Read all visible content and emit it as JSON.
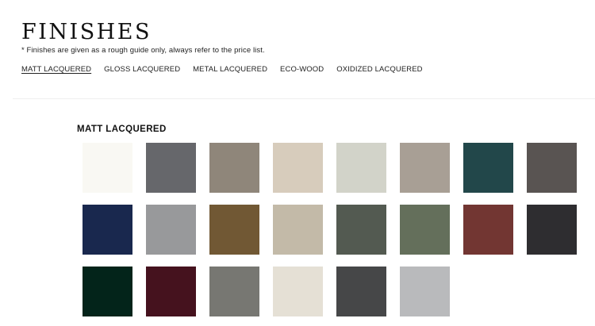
{
  "header": {
    "title": "FINISHES",
    "note": "* Finishes are given as a rough guide only, always refer to the price list."
  },
  "tabs": [
    {
      "label": "MATT LACQUERED",
      "active": true
    },
    {
      "label": "GLOSS LACQUERED",
      "active": false
    },
    {
      "label": "METAL LACQUERED",
      "active": false
    },
    {
      "label": "ECO-WOOD",
      "active": false
    },
    {
      "label": "OXIDIZED LACQUERED",
      "active": false
    }
  ],
  "section": {
    "title": "MATT LACQUERED",
    "swatches": [
      {
        "color": "#f9f8f3"
      },
      {
        "color": "#66676b"
      },
      {
        "color": "#8f867a"
      },
      {
        "color": "#d7ccbc"
      },
      {
        "color": "#d2d3c9"
      },
      {
        "color": "#a89f95"
      },
      {
        "color": "#22474a"
      },
      {
        "color": "#595452"
      },
      {
        "color": "#19284e"
      },
      {
        "color": "#98999b"
      },
      {
        "color": "#715834"
      },
      {
        "color": "#c3baa8"
      },
      {
        "color": "#535a51"
      },
      {
        "color": "#646f5b"
      },
      {
        "color": "#723632"
      },
      {
        "color": "#2e2d30"
      },
      {
        "color": "#03241a"
      },
      {
        "color": "#45121e"
      },
      {
        "color": "#777772"
      },
      {
        "color": "#e5e0d5"
      },
      {
        "color": "#464748"
      },
      {
        "color": "#b9babc"
      }
    ]
  }
}
